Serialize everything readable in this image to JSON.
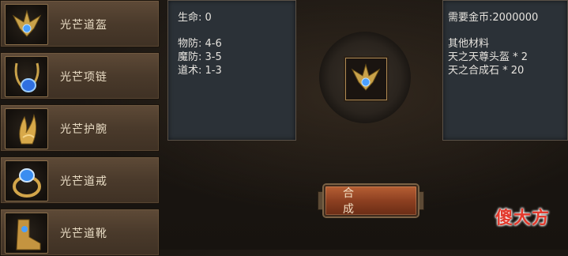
{
  "items": [
    {
      "name": "光芒道盔",
      "icon": "helmet-icon"
    },
    {
      "name": "光芒项链",
      "icon": "necklace-icon"
    },
    {
      "name": "光芒护腕",
      "icon": "bracer-icon"
    },
    {
      "name": "光芒道戒",
      "icon": "ring-icon"
    },
    {
      "name": "光芒道靴",
      "icon": "boots-icon"
    }
  ],
  "stats": {
    "hp": "生命: 0",
    "pdef": "物防: 4-6",
    "mdef": "魔防: 3-5",
    "taoism": "道术: 1-3"
  },
  "requirements": {
    "gold": "需要金币:2000000",
    "other_title": "其他材料",
    "mat1": "天之天尊头盔 * 2",
    "mat2": "天之合成石 * 20"
  },
  "center": {
    "icon": "helmet-icon"
  },
  "synthesize_label": "合 成",
  "watermark": "傻大方",
  "colors": {
    "accent": "#b65f34",
    "panel": "#2b3137",
    "list": "#4a3a2b"
  }
}
